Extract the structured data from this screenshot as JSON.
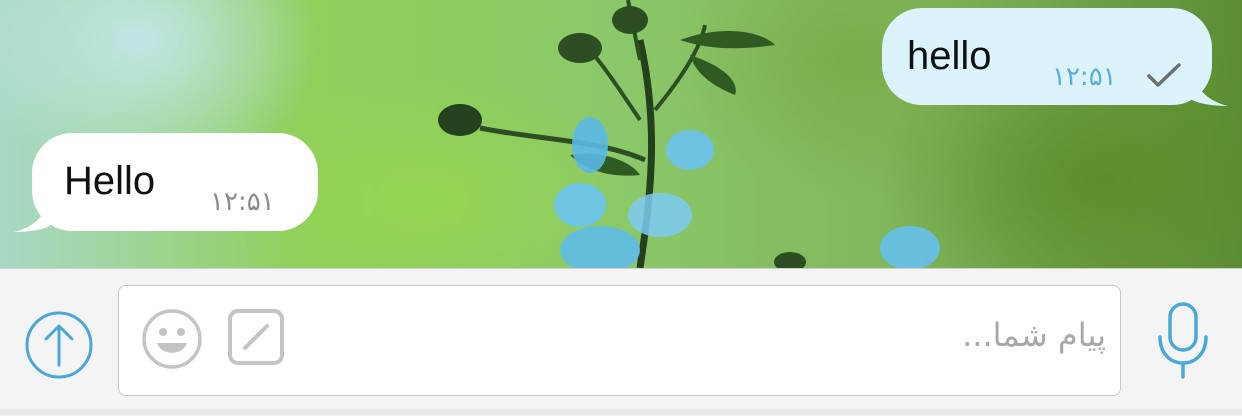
{
  "messages": [
    {
      "direction": "outgoing",
      "text": "hello",
      "time": "۱۲:۵۱",
      "status_icon": "check-icon"
    },
    {
      "direction": "incoming",
      "text": "Hello",
      "time": "۱۲:۵۱"
    }
  ],
  "composer": {
    "placeholder": "پیام شما...",
    "send_icon": "arrow-up-circle-icon",
    "emoji_icon": "smiley-icon",
    "attach_icon": "sticker-icon",
    "mic_icon": "microphone-icon"
  },
  "colors": {
    "outgoing_bubble": "#dcf3fb",
    "incoming_bubble": "#ffffff",
    "accent": "#4aa8d8",
    "outgoing_time": "#5aaed8",
    "incoming_time": "#8a8a8a"
  }
}
